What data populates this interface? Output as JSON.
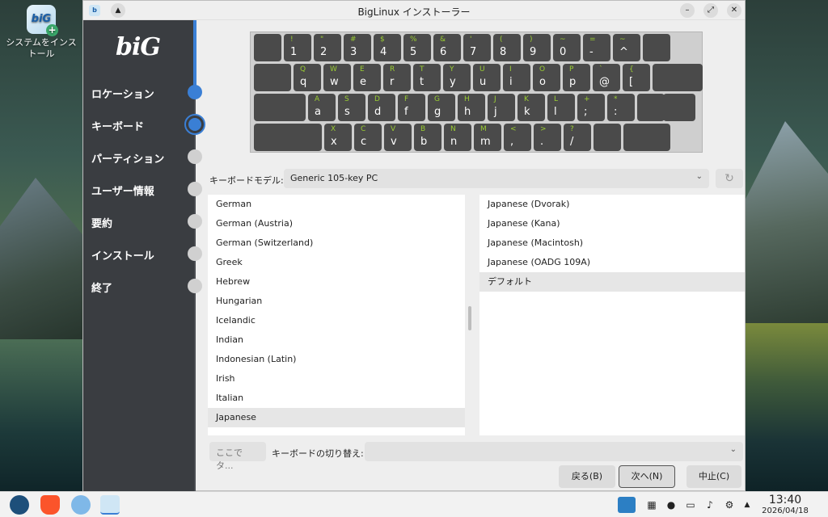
{
  "desktop": {
    "icon_label": "システムをインストール",
    "icon_glyph": "biG"
  },
  "window": {
    "title": "BigLinux インストーラー",
    "controls": {
      "minimize": "–",
      "maximize": "⤢",
      "close": "✕",
      "shade": "▲"
    }
  },
  "sidebar": {
    "logo": "biG",
    "steps": [
      {
        "label": "ロケーション",
        "state": "done"
      },
      {
        "label": "キーボード",
        "state": "active"
      },
      {
        "label": "パーティション",
        "state": "pending"
      },
      {
        "label": "ユーザー情報",
        "state": "pending"
      },
      {
        "label": "要約",
        "state": "pending"
      },
      {
        "label": "インストール",
        "state": "pending"
      },
      {
        "label": "終了",
        "state": "pending"
      }
    ],
    "accent": "#3a7fd5"
  },
  "keyboard": {
    "rows": [
      [
        [
          "",
          ""
        ],
        [
          "!",
          "1"
        ],
        [
          "\"",
          "2"
        ],
        [
          "#",
          "3"
        ],
        [
          "$",
          "4"
        ],
        [
          "%",
          "5"
        ],
        [
          "&",
          "6"
        ],
        [
          "'",
          "7"
        ],
        [
          "(",
          "8"
        ],
        [
          ")",
          "9"
        ],
        [
          "~",
          "0"
        ],
        [
          "=",
          "-"
        ],
        [
          "~",
          "^"
        ],
        [
          "",
          ""
        ]
      ],
      [
        [
          "",
          ""
        ],
        [
          "Q",
          "q"
        ],
        [
          "W",
          "w"
        ],
        [
          "E",
          "e"
        ],
        [
          "R",
          "r"
        ],
        [
          "T",
          "t"
        ],
        [
          "Y",
          "y"
        ],
        [
          "U",
          "u"
        ],
        [
          "I",
          "i"
        ],
        [
          "O",
          "o"
        ],
        [
          "P",
          "p"
        ],
        [
          "`",
          "@"
        ],
        [
          "{",
          "["
        ],
        [
          "",
          ""
        ]
      ],
      [
        [
          "",
          ""
        ],
        [
          "A",
          "a"
        ],
        [
          "S",
          "s"
        ],
        [
          "D",
          "d"
        ],
        [
          "F",
          "f"
        ],
        [
          "G",
          "g"
        ],
        [
          "H",
          "h"
        ],
        [
          "J",
          "j"
        ],
        [
          "K",
          "k"
        ],
        [
          "L",
          "l"
        ],
        [
          "+",
          ";"
        ],
        [
          "*",
          ":"
        ],
        [
          "",
          ""
        ]
      ],
      [
        [
          "",
          ""
        ],
        [
          "X",
          "x"
        ],
        [
          "C",
          "c"
        ],
        [
          "V",
          "v"
        ],
        [
          "B",
          "b"
        ],
        [
          "N",
          "n"
        ],
        [
          "M",
          "m"
        ],
        [
          "<",
          ","
        ],
        [
          ">",
          "."
        ],
        [
          "?",
          "/"
        ],
        [
          "",
          ""
        ],
        [
          "",
          ""
        ]
      ]
    ]
  },
  "model": {
    "label": "キーボードモデル:",
    "value": "Generic 105-key PC",
    "reset_glyph": "↻"
  },
  "layouts": [
    "German",
    "German (Austria)",
    "German (Switzerland)",
    "Greek",
    "Hebrew",
    "Hungarian",
    "Icelandic",
    "Indian",
    "Indonesian (Latin)",
    "Irish",
    "Italian",
    "Japanese"
  ],
  "layouts_selected": "Japanese",
  "variants": [
    "Japanese (Dvorak)",
    "Japanese (Kana)",
    "Japanese (Macintosh)",
    "Japanese (OADG 109A)",
    "デフォルト"
  ],
  "variants_selected": "デフォルト",
  "test": {
    "placeholder": "ここでタ..."
  },
  "switch": {
    "label": "キーボードの切り替え:",
    "value": ""
  },
  "buttons": {
    "back": "戻る(B)",
    "next": "次へ(N)",
    "cancel": "中止(C)"
  },
  "taskbar": {
    "time": "13:40",
    "date": "2026/04/18",
    "tray_icons": [
      "network-icon",
      "record-icon",
      "window-icon",
      "volume-icon",
      "gear-icon",
      "expand-up-icon"
    ]
  }
}
